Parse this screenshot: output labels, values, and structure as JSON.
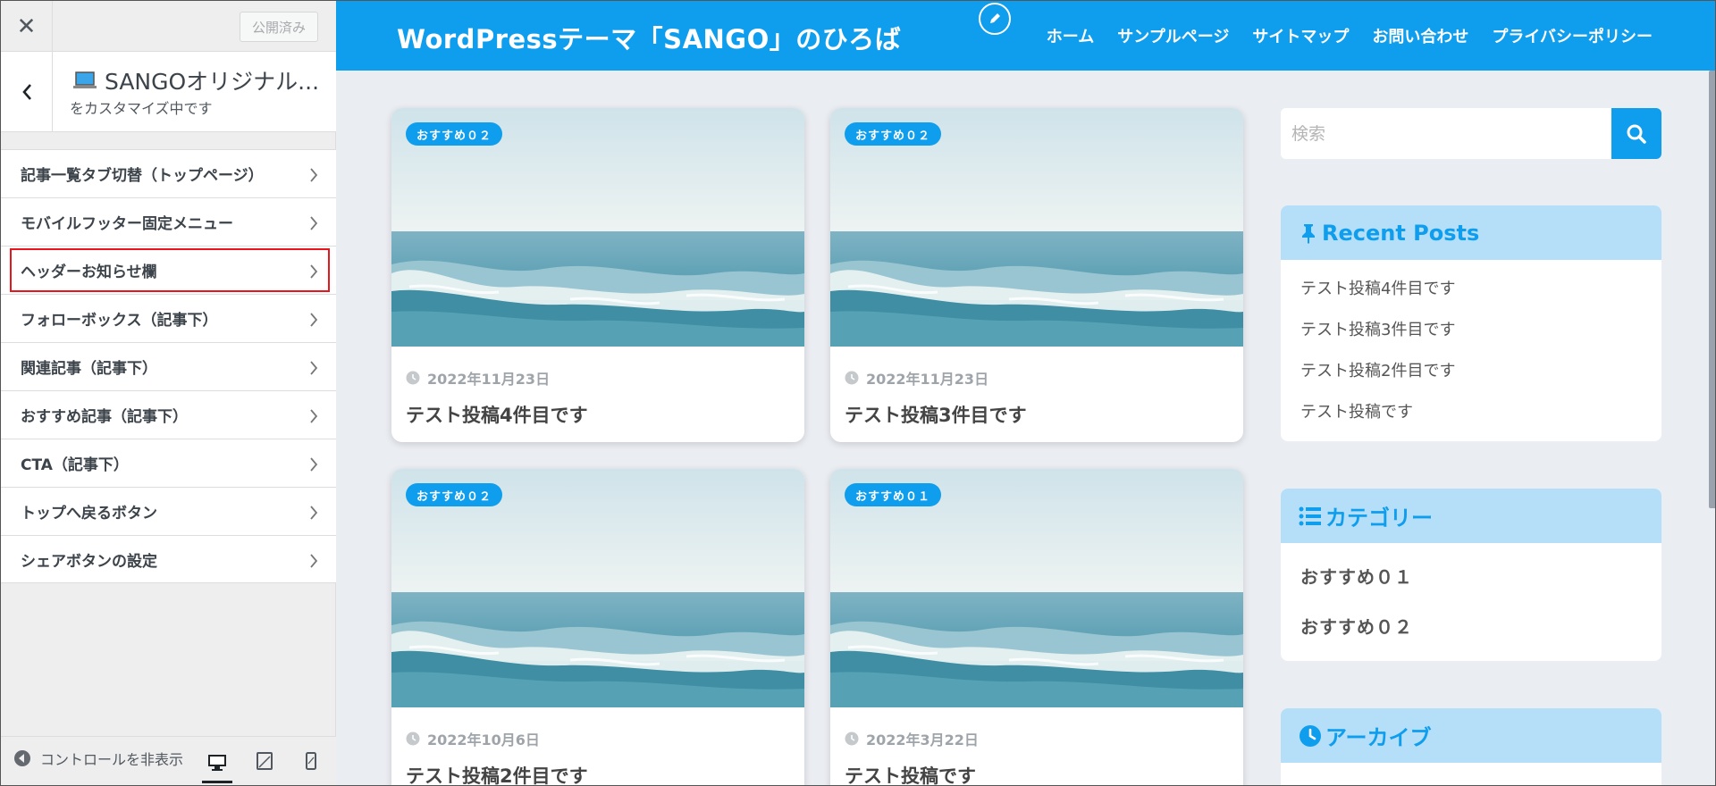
{
  "panel": {
    "close_icon": "close-icon",
    "publish_label": "公開済み",
    "info_title": "SANGOオリジナル...",
    "info_sub": "をカスタマイズ中です",
    "menu_items": [
      {
        "label": "記事一覧タブ切替（トップページ）"
      },
      {
        "label": "モバイルフッター固定メニュー"
      },
      {
        "label": "ヘッダーお知らせ欄",
        "highlighted": true
      },
      {
        "label": "フォローボックス（記事下）"
      },
      {
        "label": "関連記事（記事下）"
      },
      {
        "label": "おすすめ記事（記事下）"
      },
      {
        "label": "CTA（記事下）"
      },
      {
        "label": "トップへ戻るボタン"
      },
      {
        "label": "シェアボタンの設定"
      }
    ],
    "footer": {
      "collapse_label": "コントロールを非表示"
    },
    "highlight_color": "#e8161c"
  },
  "site": {
    "title": "WordPressテーマ「SANGO」のひろば",
    "nav": [
      "ホーム",
      "サンプルページ",
      "サイトマップ",
      "お問い合わせ",
      "プライバシーポリシー"
    ],
    "accent": "#0f9dee"
  },
  "cards": [
    {
      "badge": "おすすめ０２",
      "date": "2022年11月23日",
      "title": "テスト投稿4件目です"
    },
    {
      "badge": "おすすめ０２",
      "date": "2022年11月23日",
      "title": "テスト投稿3件目です"
    },
    {
      "badge": "おすすめ０２",
      "date": "2022年10月6日",
      "title": "テスト投稿2件目です"
    },
    {
      "badge": "おすすめ０１",
      "date": "2022年3月22日",
      "title": "テスト投稿です"
    }
  ],
  "sidebar": {
    "search_placeholder": "検索",
    "recent": {
      "title": "Recent Posts",
      "items": [
        "テスト投稿4件目です",
        "テスト投稿3件目です",
        "テスト投稿2件目です",
        "テスト投稿です"
      ]
    },
    "categories": {
      "title": "カテゴリー",
      "items": [
        "おすすめ０１",
        "おすすめ０２"
      ]
    },
    "archive": {
      "title": "アーカイブ"
    }
  }
}
